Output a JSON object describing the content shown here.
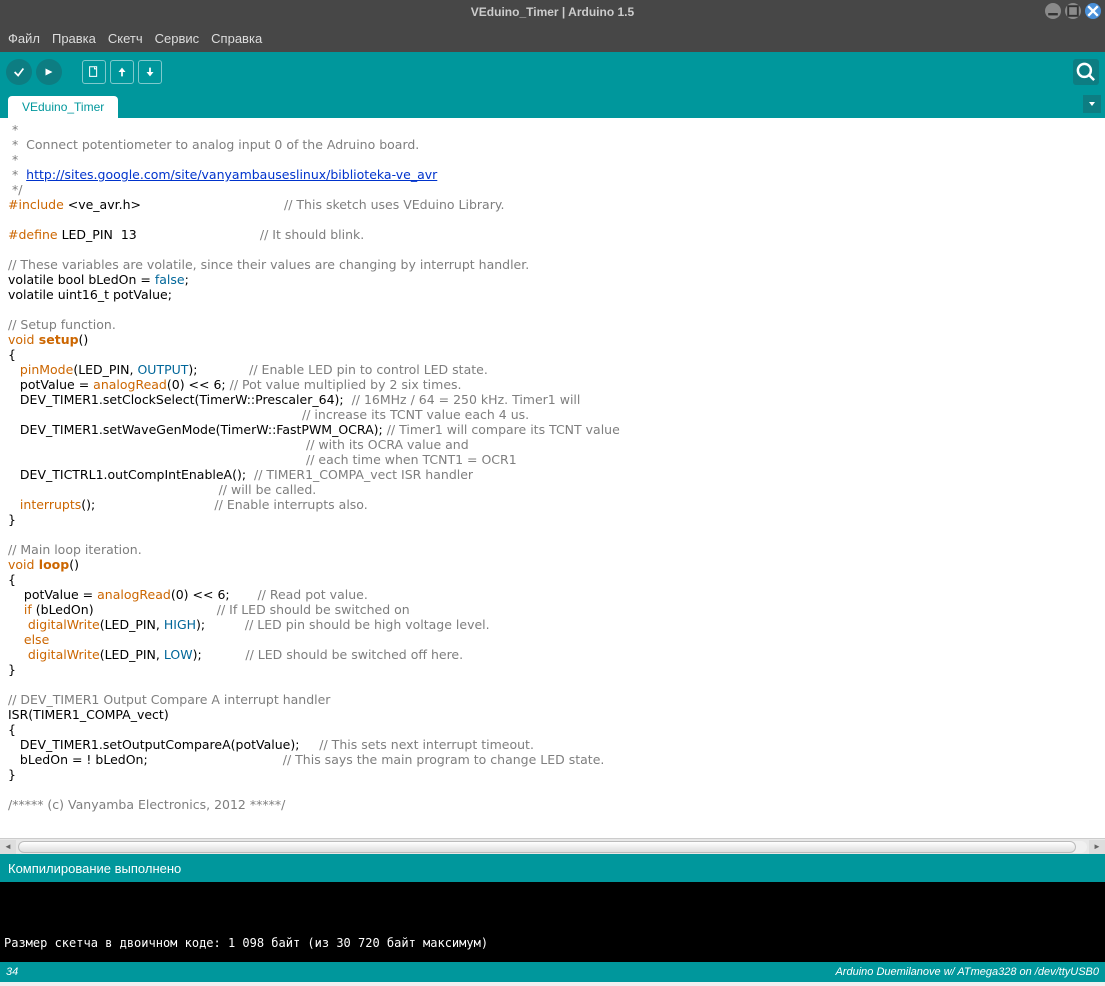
{
  "window": {
    "title": "VEduino_Timer | Arduino 1.5"
  },
  "menu": {
    "file": "Файл",
    "edit": "Правка",
    "sketch": "Скетч",
    "service": "Сервис",
    "help": "Справка"
  },
  "tab": {
    "name": "VEduino_Timer"
  },
  "code": {
    "l1": " *",
    "l2": " *  Connect potentiometer to analog input 0 of the Adruino board.",
    "l3": " *",
    "l4a": " *  ",
    "l4link": "http://sites.google.com/site/vanyambauseslinux/biblioteka-ve_avr",
    "l5": " */",
    "l6a": "#include ",
    "l6b": "<ve_avr.h>",
    "l6c": "                                    // This sketch uses VEduino Library.",
    "l8a": "#define ",
    "l8b": "LED_PIN  13",
    "l8c": "                               // It should blink.",
    "l10": "// These variables are volatile, since their values are changing by interrupt handler.",
    "l11a": "volatile bool bLedOn = ",
    "l11b": "false",
    "l11c": ";",
    "l12": "volatile uint16_t potValue;",
    "l14": "// Setup function.",
    "l15a": "void",
    "l15b": " setup",
    "l15c": "()",
    "l16": "{",
    "l17a": "   pinMode",
    "l17b": "(LED_PIN, ",
    "l17c": "OUTPUT",
    "l17d": ");             ",
    "l17e": "// Enable LED pin to control LED state.",
    "l18a": "   potValue = ",
    "l18b": "analogRead",
    "l18c": "(0) << 6; ",
    "l18d": "// Pot value multiplied by 2 six times.",
    "l19a": "   DEV_TIMER1.setClockSelect(TimerW::Prescaler_64);  ",
    "l19b": "// 16MHz / 64 = 250 kHz. Timer1 will",
    "l20": "                                                                          // increase its TCNT value each 4 us.",
    "l21a": "   DEV_TIMER1.setWaveGenMode(TimerW::FastPWM_OCRA); ",
    "l21b": "// Timer1 will compare its TCNT value",
    "l22": "                                                                           // with its OCRA value and",
    "l23": "                                                                           // each time when TCNT1 = OCR1",
    "l24a": "   DEV_TICTRL1.outCompIntEnableA();  ",
    "l24b": "// TIMER1_COMPA_vect ISR handler",
    "l25": "                                                     // will be called.",
    "l26a": "   interrupts",
    "l26b": "();                              ",
    "l26c": "// Enable interrupts also.",
    "l27": "}",
    "l29": "// Main loop iteration.",
    "l30a": "void",
    "l30b": " loop",
    "l30c": "()",
    "l31": "{",
    "l32a": "    potValue = ",
    "l32b": "analogRead",
    "l32c": "(0) << 6;       ",
    "l32d": "// Read pot value.",
    "l33a": "    if",
    "l33b": " (bLedOn)                               ",
    "l33c": "// If LED should be switched on",
    "l34a": "     digitalWrite",
    "l34b": "(LED_PIN, ",
    "l34c": "HIGH",
    "l34d": ");          ",
    "l34e": "// LED pin should be high voltage level.",
    "l35a": "    else",
    "l36a": "     digitalWrite",
    "l36b": "(LED_PIN, ",
    "l36c": "LOW",
    "l36d": ");           ",
    "l36e": "// LED should be switched off here.",
    "l37": "}",
    "l39": "// DEV_TIMER1 Output Compare A interrupt handler",
    "l40": "ISR(TIMER1_COMPA_vect)",
    "l41": "{",
    "l42a": "   DEV_TIMER1.setOutputCompareA(potValue);     ",
    "l42b": "// This sets next interrupt timeout.",
    "l43a": "   bLedOn = ! bLedOn;                                  ",
    "l43b": "// This says the main program to change LED state.",
    "l44": "}",
    "l46": "/***** (c) Vanyamba Electronics, 2012 *****/"
  },
  "status": {
    "message": "Компилирование выполнено"
  },
  "console": {
    "line1": "Размер скетча в двоичном коде: 1 098 байт (из 30 720 байт максимум)"
  },
  "footer": {
    "line": "34",
    "board": "Arduino Duemilanove w/ ATmega328 on /dev/ttyUSB0"
  }
}
